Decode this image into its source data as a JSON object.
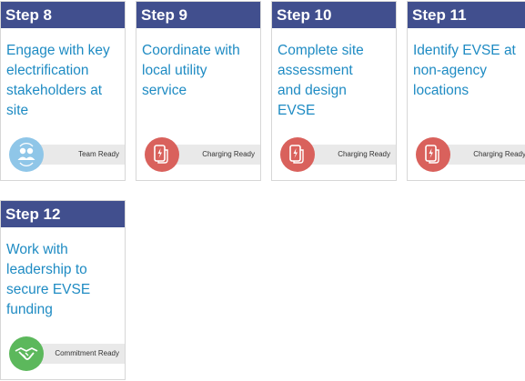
{
  "cards": [
    {
      "step": "Step 8",
      "lines": [
        "Engage with key",
        "electrification",
        "stakeholders at",
        "site"
      ],
      "badge_label": "Team Ready",
      "badge_icon": "team-icon",
      "badge_color": "#8fc6e8"
    },
    {
      "step": "Step 9",
      "lines": [
        "Coordinate with",
        "local utility",
        "service"
      ],
      "badge_label": "Charging Ready",
      "badge_icon": "charging-icon",
      "badge_color": "#d9615c"
    },
    {
      "step": "Step 10",
      "lines": [
        "Complete site",
        "assessment",
        "and design",
        "EVSE"
      ],
      "badge_label": "Charging Ready",
      "badge_icon": "charging-icon",
      "badge_color": "#d9615c"
    },
    {
      "step": "Step 11",
      "lines": [
        "Identify EVSE at",
        "non-agency",
        "locations"
      ],
      "badge_label": "Charging Ready",
      "badge_icon": "charging-icon",
      "badge_color": "#d9615c"
    },
    {
      "step": "Step 12",
      "lines": [
        "Work with",
        "leadership to",
        "secure EVSE",
        "funding"
      ],
      "badge_label": "Commitment Ready",
      "badge_icon": "handshake-icon",
      "badge_color": "#5cb85c"
    }
  ],
  "colors": {
    "header": "#414f8e",
    "text": "#1e8bc3",
    "strip": "#e9e9e9"
  }
}
